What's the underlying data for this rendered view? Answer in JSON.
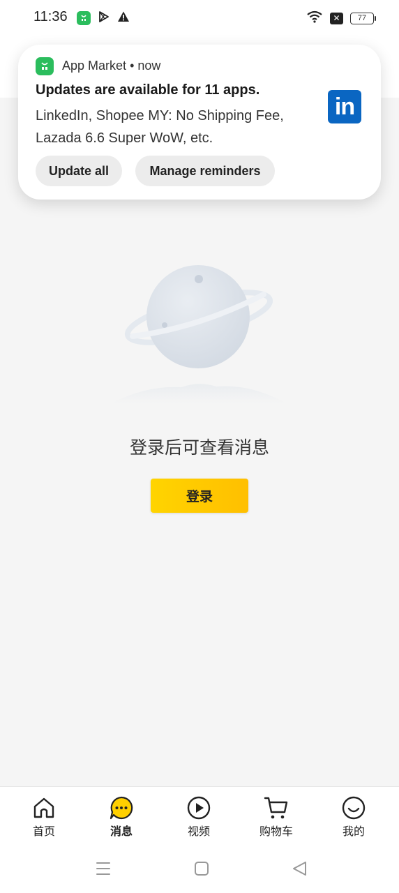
{
  "status_bar": {
    "time": "11:36",
    "battery": "77",
    "icons": [
      "app-market-icon",
      "play-store-icon",
      "warning-icon",
      "wifi-icon",
      "no-sim-icon",
      "battery-icon"
    ]
  },
  "notification": {
    "app_name": "App Market",
    "time": "now",
    "separator": "•",
    "title": "Updates are available for 11 apps.",
    "body": "LinkedIn, Shopee MY: No Shipping Fee, Lazada 6.6 Super WoW, etc.",
    "linkedin_logo_text": "in",
    "buttons": {
      "update_all": "Update all",
      "manage_reminders": "Manage reminders"
    }
  },
  "empty_state": {
    "message": "登录后可查看消息",
    "login_button": "登录"
  },
  "tabbar": {
    "tabs": [
      {
        "label": "首页",
        "icon": "home-icon",
        "active": false
      },
      {
        "label": "消息",
        "icon": "message-icon",
        "active": true
      },
      {
        "label": "视频",
        "icon": "video-icon",
        "active": false
      },
      {
        "label": "购物车",
        "icon": "cart-icon",
        "active": false
      },
      {
        "label": "我的",
        "icon": "profile-icon",
        "active": false
      }
    ]
  },
  "colors": {
    "accent_yellow": "#ffcc00",
    "app_market_green": "#2bbd5d",
    "linkedin_blue": "#0a66c2",
    "background": "#f5f5f5"
  }
}
